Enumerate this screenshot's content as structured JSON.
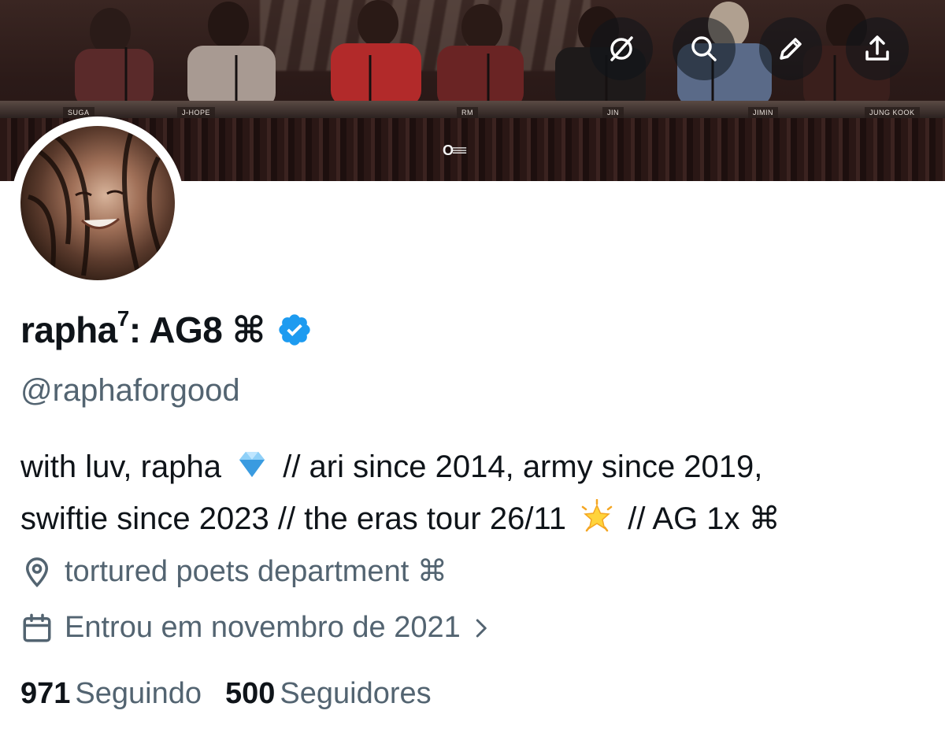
{
  "banner": {
    "nameplates": [
      "SUGA",
      "J-HOPE",
      "RM",
      "JIN",
      "JIMIN",
      "JUNG KOOK"
    ],
    "logo": "O≡≡"
  },
  "header_actions": {
    "icons": [
      "unfollow-icon",
      "search-icon",
      "edit-icon",
      "share-icon"
    ]
  },
  "profile": {
    "display_name": "rapha",
    "display_name_sup": "7",
    "display_name_suffix": ": AG8 ⌘",
    "verified": true,
    "handle": "@raphaforgood",
    "bio_line1_a": "with luv, rapha",
    "bio_line1_b": "// ari since 2014, army since 2019,",
    "bio_line2_a": "swiftie since 2023 // the eras tour 26/11",
    "bio_line2_b": "// AG 1x ⌘",
    "location": "tortured poets department ⌘",
    "joined": "Entrou em novembro de 2021"
  },
  "stats": {
    "following_count": "971",
    "following_label": "Seguindo",
    "followers_count": "500",
    "followers_label": "Seguidores"
  },
  "colors": {
    "text_primary": "#0f1419",
    "text_secondary": "#536471",
    "verified_blue": "#1d9bf0"
  }
}
